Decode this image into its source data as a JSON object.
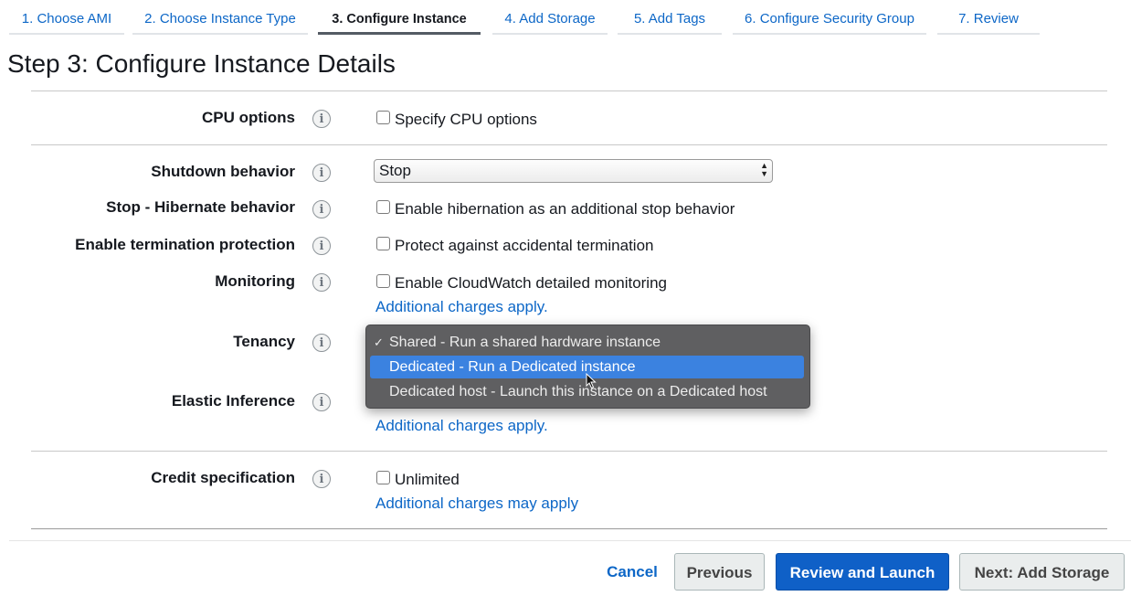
{
  "wizard": {
    "steps": [
      {
        "label": "1. Choose AMI"
      },
      {
        "label": "2. Choose Instance Type"
      },
      {
        "label": "3. Configure Instance"
      },
      {
        "label": "4. Add Storage"
      },
      {
        "label": "5. Add Tags"
      },
      {
        "label": "6. Configure Security Group"
      },
      {
        "label": "7. Review"
      }
    ],
    "active_step": 3
  },
  "page": {
    "title": "Step 3: Configure Instance Details"
  },
  "info_icon": "i",
  "fields": {
    "cpu_options": {
      "label": "CPU options",
      "checkbox_label": "Specify CPU options",
      "checked": false
    },
    "shutdown": {
      "label": "Shutdown behavior",
      "value": "Stop"
    },
    "hibernate": {
      "label": "Stop - Hibernate behavior",
      "checkbox_label": "Enable hibernation as an additional stop behavior",
      "checked": false
    },
    "termination": {
      "label": "Enable termination protection",
      "checkbox_label": "Protect against accidental termination",
      "checked": false
    },
    "monitoring": {
      "label": "Monitoring",
      "checkbox_label": "Enable CloudWatch detailed monitoring",
      "checked": false,
      "note": "Additional charges apply."
    },
    "tenancy": {
      "label": "Tenancy",
      "options": [
        {
          "label": "Shared - Run a shared hardware instance",
          "checked": true
        },
        {
          "label": "Dedicated - Run a Dedicated instance",
          "highlighted": true
        },
        {
          "label": "Dedicated host - Launch this instance on a Dedicated host"
        }
      ],
      "check_mark": "✓"
    },
    "elastic_inference": {
      "label": "Elastic Inference",
      "note": "Additional charges apply."
    },
    "credit": {
      "label": "Credit specification",
      "checkbox_label": "Unlimited",
      "checked": false,
      "note": "Additional charges may apply"
    }
  },
  "footer": {
    "cancel": "Cancel",
    "previous": "Previous",
    "review_launch": "Review and Launch",
    "next": "Next: Add Storage"
  },
  "colors": {
    "link": "#0d67c7",
    "primary": "#0f60c7",
    "menu_bg": "#5f5f61",
    "menu_highlight": "#3b82e0"
  }
}
